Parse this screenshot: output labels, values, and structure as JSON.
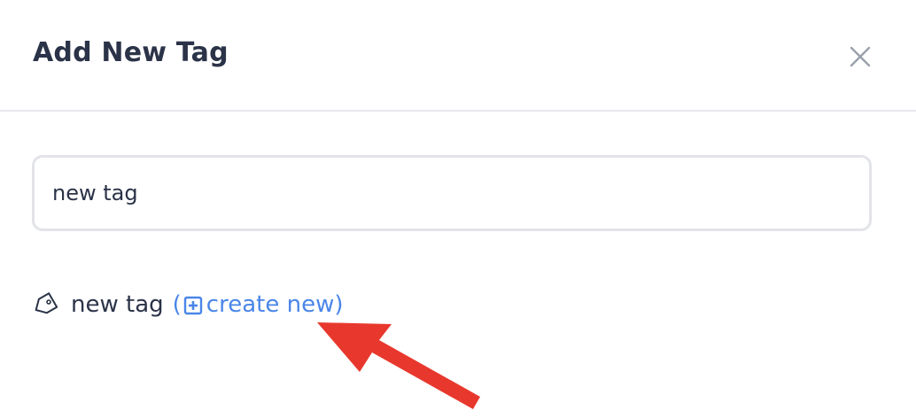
{
  "dialog": {
    "title": "Add New Tag",
    "close_icon": "close-icon"
  },
  "tag_input": {
    "value": "new tag"
  },
  "suggestion": {
    "tag_icon": "tag-icon",
    "tag_name": "new tag",
    "open_paren": "(",
    "plus_icon": "plus-square-icon",
    "create_label": "create new",
    "close_paren": ")"
  },
  "colors": {
    "title": "#2b3348",
    "link": "#4a86e8",
    "border": "#e2e4e8",
    "annotation_arrow": "#e8382d"
  }
}
